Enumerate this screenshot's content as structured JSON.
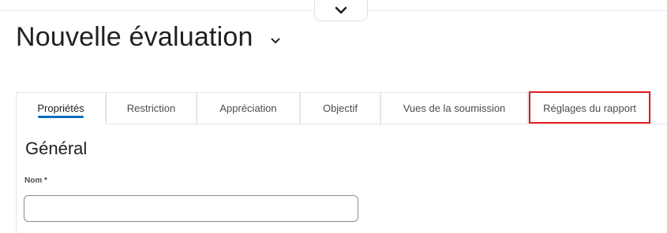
{
  "header": {
    "title": "Nouvelle évaluation",
    "collapse_icon": "chevron-down-icon",
    "title_menu_icon": "chevron-down-icon"
  },
  "tabs": [
    {
      "label": "Propriétés",
      "active": true
    },
    {
      "label": "Restriction",
      "active": false
    },
    {
      "label": "Appréciation",
      "active": false
    },
    {
      "label": "Objectif",
      "active": false
    },
    {
      "label": "Vues de la soumission",
      "active": false
    },
    {
      "label": "Réglages du rapport",
      "active": false,
      "highlighted": true
    }
  ],
  "section": {
    "title": "Général"
  },
  "name_field": {
    "label": "Nom *",
    "value": "",
    "placeholder": ""
  },
  "colors": {
    "active_tab_underline": "#006fbf",
    "highlight_box": "#e41c1c",
    "text": "#202122",
    "muted_text": "#494c4e"
  }
}
